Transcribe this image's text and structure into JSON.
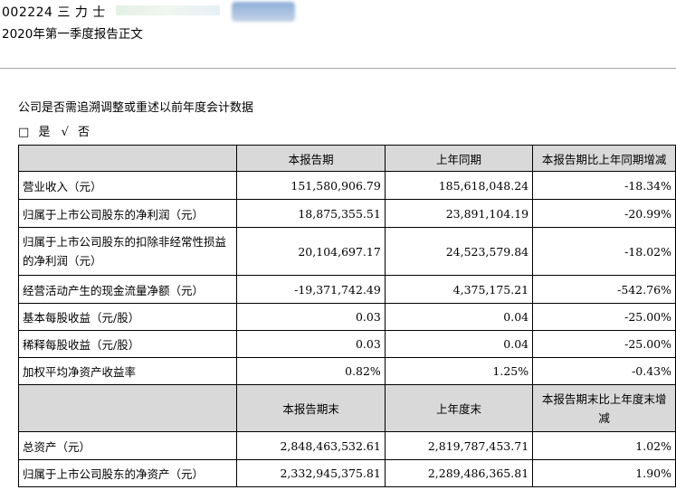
{
  "header": {
    "code_name": "002224 三 力 士",
    "report_title": "2020年第一季度报告正文"
  },
  "question": "公司是否需追溯调整或重述以前年度会计数据",
  "options": {
    "yes_box": "□",
    "yes_label": "是",
    "no_check": "√",
    "no_label": "否"
  },
  "table1": {
    "headers": [
      "",
      "本报告期",
      "上年同期",
      "本报告期比上年同期增减"
    ],
    "rows": [
      {
        "label": "营业收入（元）",
        "current": "151,580,906.79",
        "prior": "185,618,048.24",
        "change": "-18.34%"
      },
      {
        "label": "归属于上市公司股东的净利润（元）",
        "current": "18,875,355.51",
        "prior": "23,891,104.19",
        "change": "-20.99%"
      },
      {
        "label": "归属于上市公司股东的扣除非经常性损益的净利润（元）",
        "current": "20,104,697.17",
        "prior": "24,523,579.84",
        "change": "-18.02%"
      },
      {
        "label": "经营活动产生的现金流量净额（元）",
        "current": "-19,371,742.49",
        "prior": "4,375,175.21",
        "change": "-542.76%"
      },
      {
        "label": "基本每股收益（元/股）",
        "current": "0.03",
        "prior": "0.04",
        "change": "-25.00%"
      },
      {
        "label": "稀释每股收益（元/股）",
        "current": "0.03",
        "prior": "0.04",
        "change": "-25.00%"
      },
      {
        "label": "加权平均净资产收益率",
        "current": "0.82%",
        "prior": "1.25%",
        "change": "-0.43%"
      }
    ]
  },
  "table2": {
    "headers": [
      "",
      "本报告期末",
      "上年度末",
      "本报告期末比上年度末增减"
    ],
    "rows": [
      {
        "label": "总资产（元）",
        "current": "2,848,463,532.61",
        "prior": "2,819,787,453.71",
        "change": "1.02%"
      },
      {
        "label": "归属于上市公司股东的净资产（元）",
        "current": "2,332,945,375.81",
        "prior": "2,289,486,365.81",
        "change": "1.90%"
      }
    ]
  }
}
